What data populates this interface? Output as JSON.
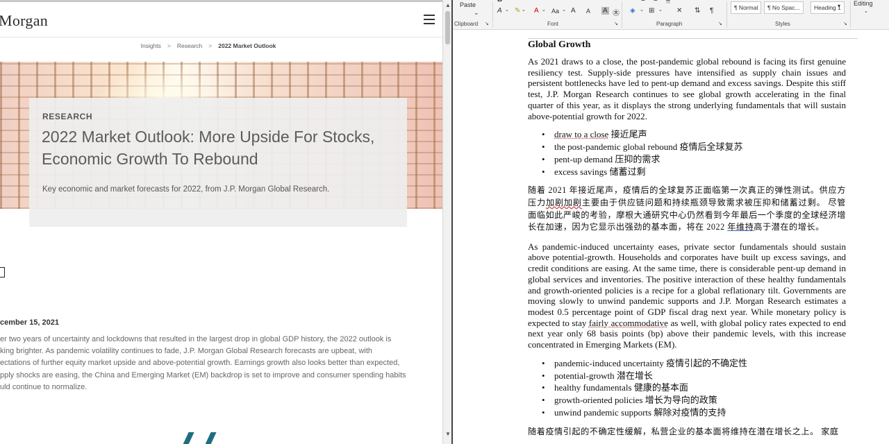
{
  "browser": {
    "logo": "Morgan",
    "breadcrumb": [
      "Insights",
      "Research",
      "2022 Market Outlook"
    ],
    "hero": {
      "kicker": "RESEARCH",
      "title": "2022 Market Outlook: More Upside For Stocks, Economic Growth To Rebound",
      "subtitle": "Key economic and market forecasts for 2022, from J.P. Morgan Global Research."
    },
    "date": "cember 15, 2021",
    "body_lines": [
      "er two years of uncertainty and lockdowns that resulted in the largest drop in global GDP history, the 2022 outlook is",
      "king brighter. As pandemic volatility continues to fade, J.P. Morgan Global Research forecasts are upbeat, with",
      "ectations of further equity market upside and above-potential growth. Earnings growth also looks better than expected,",
      "pply shocks are easing, the China and Emerging Market (EM) backdrop is set to improve and consumer spending habits",
      "uld continue to normalize."
    ]
  },
  "word": {
    "ribbon": {
      "paste": "Paste",
      "clipboard": "Clipboard",
      "font": "Font",
      "paragraph": "Paragraph",
      "styles": "Styles",
      "editing": "Editing",
      "style_normal": "¶ Normal",
      "style_nospacing": "¶ No Spac...",
      "style_heading1": "Heading 1"
    },
    "doc": {
      "heading": "Global Growth",
      "para1": "As 2021 draws to a close, the post-pandemic global rebound is facing its first genuine resiliency test. Supply-side pressures have intensified as supply chain issues and persistent bottlenecks have led to pent-up demand and excess savings. Despite this stiff test, J.P. Morgan Research continues to see global growth accelerating in the final quarter of this year, as it displays the strong underlying fundamentals that will sustain above-potential growth for 2022.",
      "bullets1": [
        {
          "en": "draw to a close",
          "zh": "接近尾声"
        },
        {
          "en": "the post-pandemic global rebound",
          "zh": "疫情后全球复苏"
        },
        {
          "en": "pent-up demand",
          "zh": "压抑的需求"
        },
        {
          "en": "excess savings",
          "zh": "储蓄过剩"
        }
      ],
      "cn1_a": "随着 2021 年接近尾声，疫情后的全球复苏正面临第一次真正的弹性测试。供应方压力",
      "cn1_b": "加剧加剧",
      "cn1_c": "主要由于供应链问题和持续瓶颈导致需求被压抑和储蓄过剩。 尽管面临如此严峻的考验，摩根大通研究中心仍然看到今年最后一个季度的全球经济增长在加速，因为它显示出强劲的基本面，将在 2022 ",
      "cn1_d": "年维持",
      "cn1_e": "高于潜在的增长。",
      "para2_a": "As pandemic-induced uncertainty eases, private sector fundamentals should sustain above potential-growth. Households and corporates have built up excess savings, and credit conditions are easing. At the same time, there is considerable pent-up demand in global services and inventories. The positive interaction of these healthy fundamentals and growth-oriented policies is a recipe for a global reflationary tilt. Governments are moving slowly to unwind pandemic supports and J.P. Morgan Research estimates a modest 0.5 percentage point of GDP fiscal drag next year. While monetary policy is expected to stay ",
      "para2_b": "fairly accommodative",
      "para2_c": " as well, with global policy rates expected to end next year only 68 basis points (bp) above their pandemic levels, with this increase concentrated in Emerging Markets (EM).",
      "bullets2": [
        {
          "en": "pandemic-induced uncertainty",
          "zh": "疫情引起的不确定性"
        },
        {
          "en": "potential-growth",
          "zh": "潜在增长"
        },
        {
          "en": "healthy fundamentals",
          "zh": "健康的基本面"
        },
        {
          "en": "growth-oriented policies",
          "zh": "增长为导向的政策"
        },
        {
          "en": "unwind pandemic supports",
          "zh": "解除对疫情的支持"
        }
      ],
      "cn2": "随着疫情引起的不确定性缓解，私营企业的基本面将维持在潜在增长之上。 家庭"
    }
  }
}
